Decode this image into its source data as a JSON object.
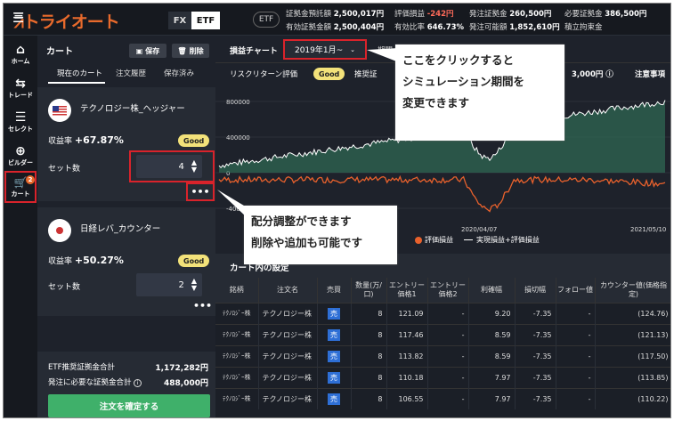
{
  "header": {
    "logo": "トライオート",
    "fx": "FX",
    "etf": "ETF",
    "badge": "ETF",
    "stats": [
      {
        "label": "証拠金預託額",
        "value": "2,500,017円"
      },
      {
        "label": "評価損益",
        "value": "-242円"
      },
      {
        "label": "発注証拠金",
        "value": "260,500円"
      },
      {
        "label": "必要証拠金",
        "value": "386,500円"
      },
      {
        "label": "有効証拠金額",
        "value": "2,500,404円"
      },
      {
        "label": "有効比率",
        "value": "646.73%"
      },
      {
        "label": "発注可能額",
        "value": "1,852,610円"
      },
      {
        "label": "積立拘束金",
        "value": ""
      }
    ]
  },
  "nav": [
    {
      "label": "ホーム",
      "icon": "home-icon",
      "glyph": "⌂"
    },
    {
      "label": "トレード",
      "icon": "trade-icon",
      "glyph": "⇆"
    },
    {
      "label": "セレクト",
      "icon": "select-icon",
      "glyph": "☰"
    },
    {
      "label": "ビルダー",
      "icon": "builder-icon",
      "glyph": "⊕"
    },
    {
      "label": "カート",
      "icon": "cart-icon",
      "glyph": "🛒",
      "badge": "2"
    }
  ],
  "cart": {
    "title": "カート",
    "save": "保存",
    "delete": "削除",
    "tabs": [
      "現在のカート",
      "注文履歴",
      "保存済み"
    ],
    "items": [
      {
        "name": "テクノロジー株_ヘッジャー",
        "return_label": "収益率",
        "return_value": "+67.87%",
        "rating": "Good",
        "sets_label": "セット数",
        "sets": "4"
      },
      {
        "name": "日経レバ_カウンター",
        "return_label": "収益率",
        "return_value": "+50.27%",
        "rating": "Good",
        "sets_label": "セット数",
        "sets": "2"
      }
    ],
    "summary": [
      {
        "label": "ETF推奨証拠金合計",
        "value": "1,172,282円"
      },
      {
        "label": "発注に必要な証拠金合計",
        "value": "488,000円"
      }
    ],
    "confirm": "注文を確定する"
  },
  "chart_panel": {
    "title": "損益チャート",
    "period": "2019年1月~",
    "period_label": "期間",
    "risk_label": "リスクリターン評価",
    "risk_value": "Good",
    "recommend_label": "推奨証",
    "recommend_value": "3,000円",
    "notes": "注意事項",
    "legend": [
      "評価損益",
      "実現損益+評価損益"
    ]
  },
  "chart_data": {
    "type": "area",
    "yticks": [
      "800000",
      "400000",
      "0",
      "-400000"
    ],
    "xticks": [
      "2020/04/07",
      "2021/05/10"
    ],
    "ylim": [
      -600000,
      900000
    ],
    "series": [
      {
        "name": "評価損益",
        "color": "#e8612c"
      },
      {
        "name": "実現損益+評価損益",
        "color": "#ffffff"
      }
    ]
  },
  "callouts": {
    "period": "ここをクリックすると\nシミュレーション期間を\n変更できます",
    "adjust": "配分調整ができます\n削除や追加も可能です"
  },
  "table": {
    "section_title": "カート内の設定",
    "headers": [
      "銘柄",
      "注文名",
      "売買",
      "数量(万/口)",
      "エントリー価格1",
      "エントリー価格2",
      "利確幅",
      "損切幅",
      "フォロー値",
      "カウンター値(価格指定)"
    ],
    "rows": [
      {
        "ticker": "ﾃｸﾉﾛｼﾞｰ株",
        "order": "テクノロジー株",
        "side": "売",
        "qty": "8",
        "e1": "121.09",
        "e2": "-",
        "tp": "9.20",
        "sl": "-7.35",
        "follow": "-",
        "counter": "(124.76)"
      },
      {
        "ticker": "ﾃｸﾉﾛｼﾞｰ株",
        "order": "テクノロジー株",
        "side": "売",
        "qty": "8",
        "e1": "117.46",
        "e2": "-",
        "tp": "8.59",
        "sl": "-7.35",
        "follow": "-",
        "counter": "(121.13)"
      },
      {
        "ticker": "ﾃｸﾉﾛｼﾞｰ株",
        "order": "テクノロジー株",
        "side": "売",
        "qty": "8",
        "e1": "113.82",
        "e2": "-",
        "tp": "8.59",
        "sl": "-7.35",
        "follow": "-",
        "counter": "(117.50)"
      },
      {
        "ticker": "ﾃｸﾉﾛｼﾞｰ株",
        "order": "テクノロジー株",
        "side": "売",
        "qty": "8",
        "e1": "110.18",
        "e2": "-",
        "tp": "7.97",
        "sl": "-7.35",
        "follow": "-",
        "counter": "(113.85)"
      },
      {
        "ticker": "ﾃｸﾉﾛｼﾞｰ株",
        "order": "テクノロジー株",
        "side": "売",
        "qty": "8",
        "e1": "106.55",
        "e2": "-",
        "tp": "7.97",
        "sl": "-7.35",
        "follow": "-",
        "counter": "(110.22)"
      }
    ]
  }
}
